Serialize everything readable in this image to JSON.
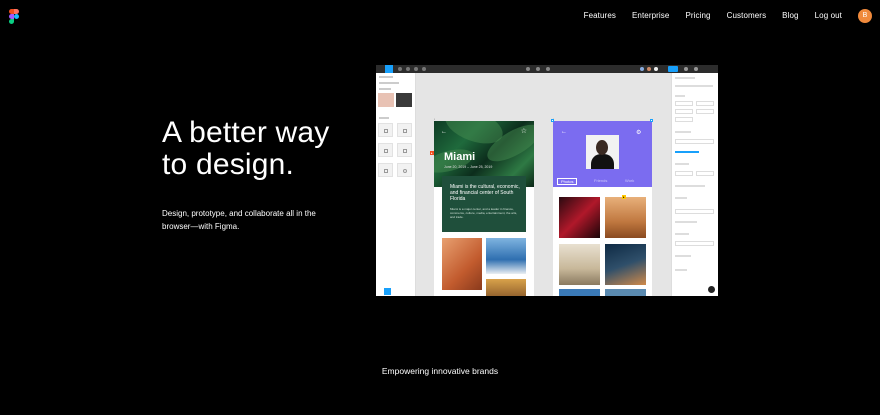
{
  "nav": {
    "links": [
      "Features",
      "Enterprise",
      "Pricing",
      "Customers",
      "Blog",
      "Log out"
    ],
    "avatar_initial": "B"
  },
  "hero": {
    "title_line1": "A better way",
    "title_line2": "to design.",
    "subtitle_line1": "Design, prototype, and collaborate all in the",
    "subtitle_line2": "browser—with Figma."
  },
  "app_preview": {
    "miami": {
      "title": "Miami",
      "dates": "June 20, 2019 – June 25, 2019",
      "card_heading": "Miami is the cultural, economic, and financial center of South Florida",
      "card_body": "Miami is a major center, and a leader in finance, commerce, culture, media, entertainment, the arts, and trade."
    },
    "profile": {
      "tabs": [
        "Photos",
        "Friends",
        "Work"
      ]
    }
  },
  "tagline": "Empowering innovative brands",
  "colors": {
    "background": "#000000",
    "avatar": "#f08a3c",
    "figma_blue": "#18a0fb",
    "profile_purple": "#7b6cf0",
    "miami_card": "#1f4f3b"
  }
}
